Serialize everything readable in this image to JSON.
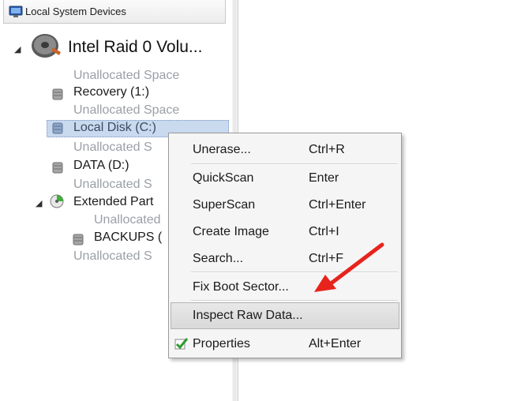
{
  "header": {
    "title": "Local System Devices",
    "icon": "monitor-icon"
  },
  "tree": {
    "disk": {
      "label": "Intel   Raid 0 Volu...",
      "icon": "hard-drive-icon",
      "expander": "◢"
    },
    "items": {
      "unalloc_1": "Unallocated Space",
      "recovery": "Recovery (1:)",
      "unalloc_2": "Unallocated Space",
      "local_disk": "Local Disk (C:)",
      "unalloc_3": "Unallocated S",
      "data": "DATA (D:)",
      "unalloc_4": "Unallocated S",
      "extended": "Extended Part",
      "ext_unalloc": "Unallocated",
      "backups": "BACKUPS (",
      "unalloc_5": "Unallocated S"
    },
    "extended_expander": "◢"
  },
  "context_menu": {
    "items": [
      {
        "label": "Unerase...",
        "shortcut": "Ctrl+R"
      },
      {
        "label": "QuickScan",
        "shortcut": "Enter"
      },
      {
        "label": "SuperScan",
        "shortcut": "Ctrl+Enter"
      },
      {
        "label": "Create Image",
        "shortcut": "Ctrl+I"
      },
      {
        "label": "Search...",
        "shortcut": "Ctrl+F"
      },
      {
        "label": "Fix Boot Sector...",
        "shortcut": ""
      },
      {
        "label": "Inspect Raw Data...",
        "shortcut": ""
      },
      {
        "label": "Properties",
        "shortcut": "Alt+Enter",
        "icon": "checkmark-icon"
      }
    ],
    "highlighted": "Inspect Raw Data..."
  },
  "colors": {
    "selection": "#c9d9ee",
    "arrow": "#e8231c",
    "gray_text": "#9a9fa6"
  }
}
